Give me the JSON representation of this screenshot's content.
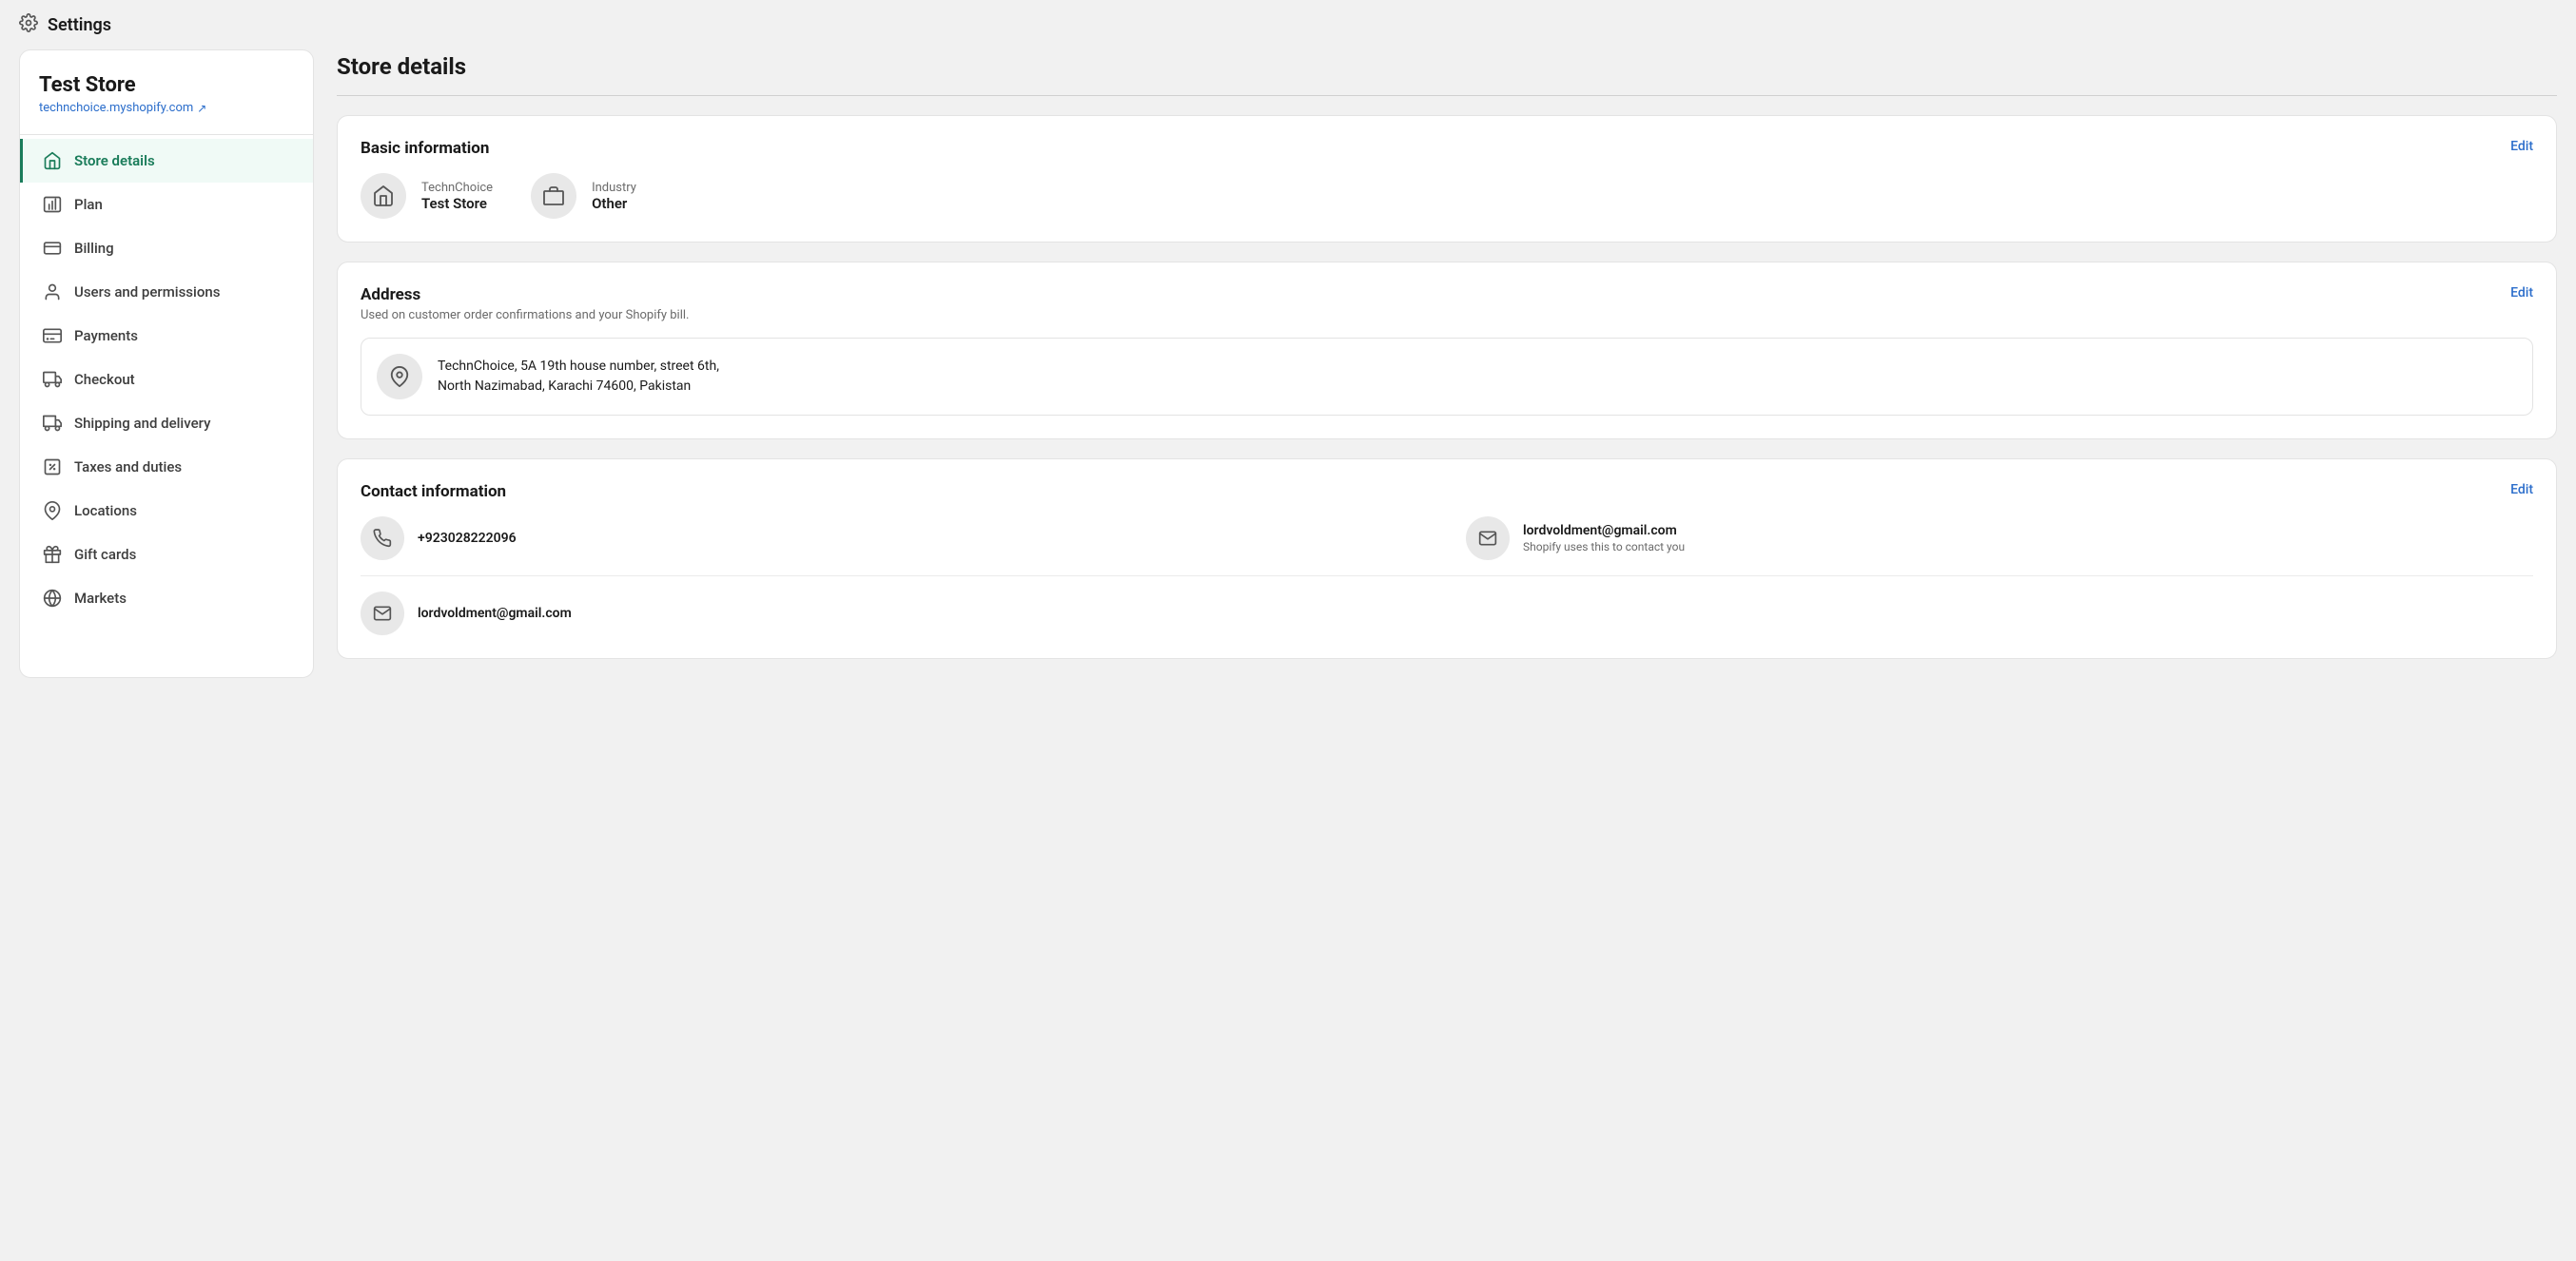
{
  "topbar": {
    "title": "Settings",
    "icon": "gear"
  },
  "sidebar": {
    "store_name": "Test Store",
    "store_link": "technchoice.myshopify.com",
    "items": [
      {
        "id": "store-details",
        "label": "Store details",
        "icon": "store",
        "active": true
      },
      {
        "id": "plan",
        "label": "Plan",
        "icon": "plan"
      },
      {
        "id": "billing",
        "label": "Billing",
        "icon": "billing"
      },
      {
        "id": "users-permissions",
        "label": "Users and permissions",
        "icon": "user"
      },
      {
        "id": "payments",
        "label": "Payments",
        "icon": "payments"
      },
      {
        "id": "checkout",
        "label": "Checkout",
        "icon": "checkout"
      },
      {
        "id": "shipping-delivery",
        "label": "Shipping and delivery",
        "icon": "shipping"
      },
      {
        "id": "taxes-duties",
        "label": "Taxes and duties",
        "icon": "taxes"
      },
      {
        "id": "locations",
        "label": "Locations",
        "icon": "location"
      },
      {
        "id": "gift-cards",
        "label": "Gift cards",
        "icon": "gift"
      },
      {
        "id": "markets",
        "label": "Markets",
        "icon": "markets"
      }
    ]
  },
  "page": {
    "title": "Store details"
  },
  "basic_info": {
    "section_title": "Basic information",
    "edit_label": "Edit",
    "store_account": "TechnChoice",
    "store_name": "Test Store",
    "industry_label": "Industry",
    "industry_value": "Other"
  },
  "address": {
    "section_title": "Address",
    "edit_label": "Edit",
    "subtitle": "Used on customer order confirmations and your Shopify bill.",
    "address_line1": "TechnChoice, 5A 19th house number, street 6th,",
    "address_line2": "North Nazimabad, Karachi 74600, Pakistan"
  },
  "contact_info": {
    "section_title": "Contact information",
    "edit_label": "Edit",
    "phone": "+923028222096",
    "email_primary": "lordvoldment@gmail.com",
    "email_primary_sub": "Shopify uses this to contact you",
    "email_secondary": "lordvoldment@gmail.com"
  },
  "icons": {
    "external_link": "↗",
    "gear": "⚙",
    "store": "🏪",
    "location_pin": "📍",
    "phone_symbol": "📞",
    "mail_symbol": "✉"
  }
}
